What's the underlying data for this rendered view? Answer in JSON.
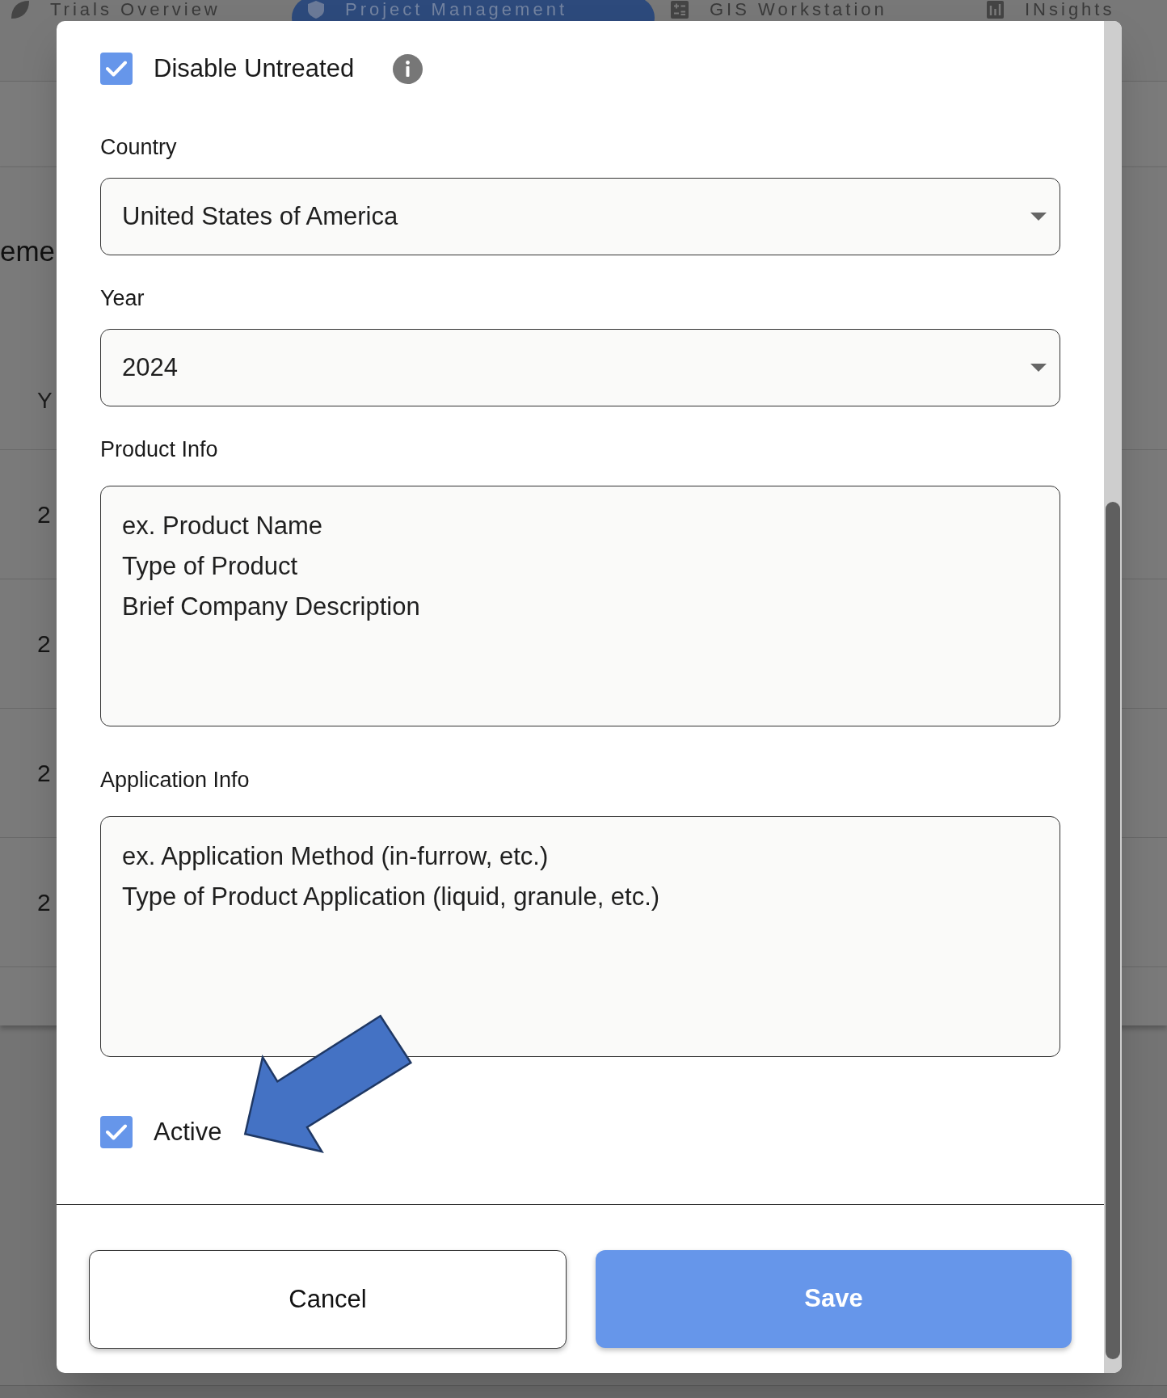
{
  "top_nav": {
    "tabs": [
      {
        "label": "Trials Overview",
        "selected": false
      },
      {
        "label": "Project Management",
        "selected": true
      },
      {
        "label": "GIS Workstation",
        "selected": false
      },
      {
        "label": "INsights",
        "selected": false
      }
    ]
  },
  "background_page": {
    "heading": "eme",
    "table": {
      "columns": [
        "Y"
      ],
      "rows": [
        [
          "2"
        ],
        [
          "2"
        ],
        [
          "2"
        ],
        [
          "2"
        ]
      ]
    }
  },
  "dialog": {
    "disable_untreated": {
      "label": "Disable Untreated",
      "checked": true
    },
    "fields": [
      {
        "kind": "select",
        "label": "Country",
        "value": "United States of America"
      },
      {
        "kind": "select",
        "label": "Year",
        "value": "2024"
      },
      {
        "kind": "textarea",
        "label": "Product Info",
        "placeholder": "ex. Product Name\nType of Product\nBrief Company Description"
      },
      {
        "kind": "textarea",
        "label": "Application Info",
        "placeholder": "ex. Application Method (in-furrow, etc.)\nType of Product Application (liquid, granule, etc.)"
      }
    ],
    "active": {
      "label": "Active",
      "checked": true
    },
    "buttons": [
      {
        "kind": "secondary",
        "label": "Cancel"
      },
      {
        "kind": "primary",
        "label": "Save"
      }
    ]
  }
}
